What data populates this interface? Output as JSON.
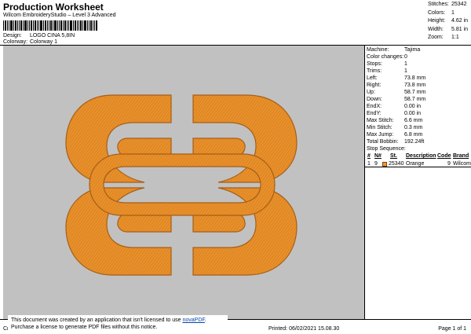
{
  "header": {
    "title": "Production Worksheet",
    "subtitle": "Wilcom EmbroideryStudio – Level 3 Advanced",
    "design_label": "Design:",
    "design_value": "LOGO CINA 5,8IN",
    "colorway_label": "Colorway:",
    "colorway_value": "Colorway 1"
  },
  "stats": [
    {
      "label": "Stitches:",
      "value": "25342"
    },
    {
      "label": "Colors:",
      "value": "1"
    },
    {
      "label": "Height:",
      "value": "4.62 in"
    },
    {
      "label": "Width:",
      "value": "5.81 in"
    },
    {
      "label": "Zoom:",
      "value": "1:1"
    }
  ],
  "machine_info": [
    {
      "label": "Machine:",
      "value": "Tajima"
    },
    {
      "label": "Color changes:",
      "value": "0"
    },
    {
      "label": "Stops:",
      "value": "1"
    },
    {
      "label": "Trims:",
      "value": "1"
    },
    {
      "label": "Left:",
      "value": "73.8 mm"
    },
    {
      "label": "Right:",
      "value": "73.8 mm"
    },
    {
      "label": "Up:",
      "value": "58.7 mm"
    },
    {
      "label": "Down:",
      "value": "58.7 mm"
    },
    {
      "label": "EndX:",
      "value": "0.00 in"
    },
    {
      "label": "EndY:",
      "value": "0.00 in"
    },
    {
      "label": "Max Stitch:",
      "value": "6.6 mm"
    },
    {
      "label": "Min Stitch:",
      "value": "0.3 mm"
    },
    {
      "label": "Max Jump:",
      "value": "6.8 mm"
    },
    {
      "label": "Total Bobbin:",
      "value": "192.24ft"
    }
  ],
  "stop_sequence": {
    "title": "Stop Sequence:",
    "headers": {
      "hash": "#",
      "n": "N#",
      "st": "St.",
      "description": "Description",
      "code": "Code",
      "brand": "Brand"
    },
    "rows": [
      {
        "hash": "1",
        "n": "9",
        "st": "25340",
        "description": "Orange",
        "code": "9",
        "brand": "Wilcom",
        "color": "#f09a2c"
      }
    ]
  },
  "footer": {
    "left_text": "Cr",
    "notice_line1": "This document was created by an application that isn't licensed to use ",
    "notice_link": "novaPDF",
    "notice_line1_end": ".",
    "notice_line2": "Purchase a license to generate PDF files without this notice.",
    "printed": "Printed: 06/02/2021 15.08.30",
    "page": "Page 1 of 1"
  },
  "colors": {
    "thread": "#e8902a",
    "thread_dark": "#b8681a",
    "background": "#c1c1c1"
  }
}
